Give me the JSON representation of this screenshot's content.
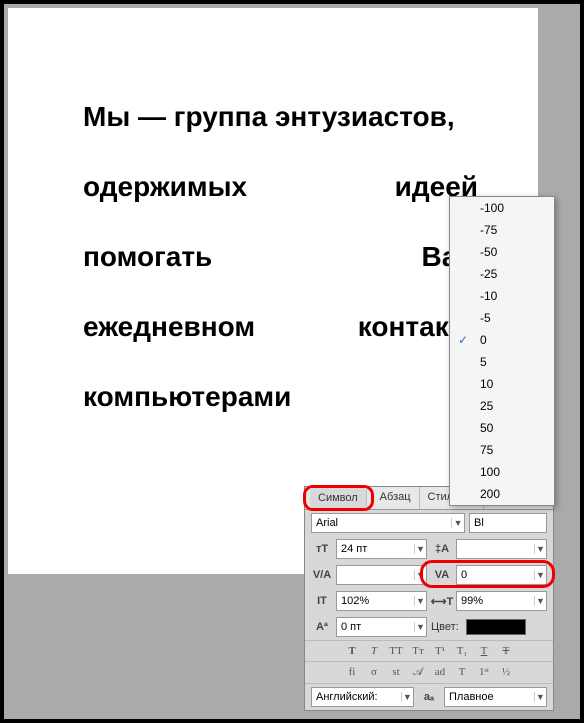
{
  "document_text": {
    "line1": "Мы — группа энтузиастов,",
    "line2a": "одержимых",
    "line2b": "идеей",
    "line3a": "помогать",
    "line3b": "Вам",
    "line4a": "ежедневном",
    "line4b": "контакте",
    "line5": "компьютерами"
  },
  "panel": {
    "tabs": {
      "symbol": "Символ",
      "paragraph": "Абзац",
      "parastyles": "Стили аб"
    },
    "font": "Arial",
    "fontstyle": "Bl",
    "size": "24 пт",
    "leading": "",
    "kerning": "",
    "tracking": "0",
    "vscale": "102%",
    "hscale": "99%",
    "baseline": "0 пт",
    "color_label": "Цвет:",
    "language": "Английский:",
    "aa": "Плавное"
  },
  "dropdown_values": [
    "-100",
    "-75",
    "-50",
    "-25",
    "-10",
    "-5",
    "0",
    "5",
    "10",
    "25",
    "50",
    "75",
    "100",
    "200"
  ],
  "dropdown_selected": "0"
}
